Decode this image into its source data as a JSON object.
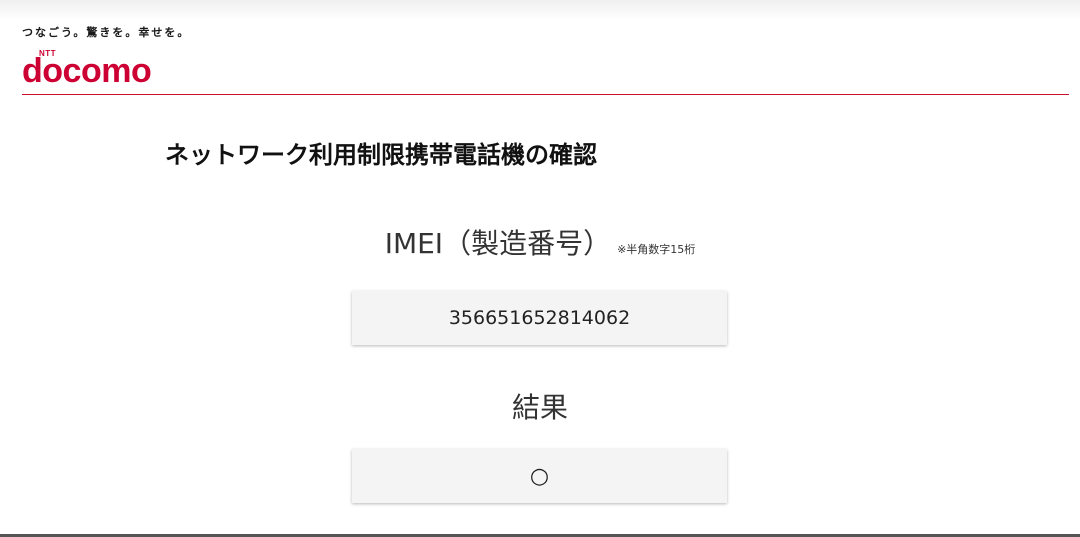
{
  "header": {
    "slogan": "つなごう。驚きを。幸せを。",
    "logo_ntt": "NTT",
    "logo_wordmark": "docomo",
    "brand_color": "#cc0033"
  },
  "page": {
    "title": "ネットワーク利用制限携帯電話機の確認"
  },
  "imei": {
    "label": "IMEI（製造番号）",
    "note": "※半角数字15桁",
    "value": "356651652814062"
  },
  "result": {
    "label": "結果",
    "value": "○"
  }
}
